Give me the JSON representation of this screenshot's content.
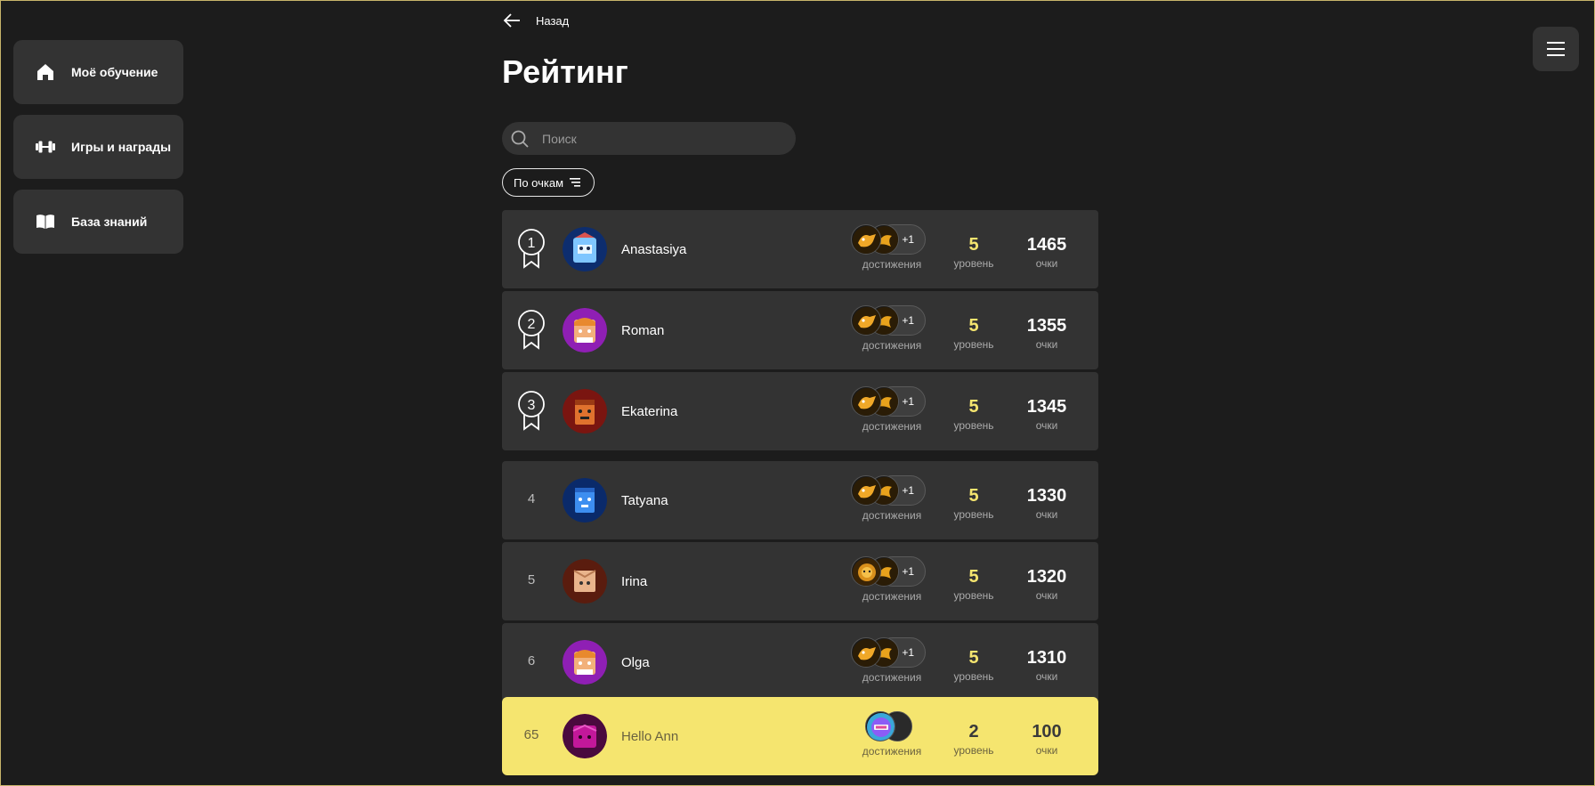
{
  "sidebar": {
    "items": [
      {
        "label": "Моё обучение",
        "icon": "home-icon"
      },
      {
        "label": "Игры и награды",
        "icon": "dumbbell-icon"
      },
      {
        "label": "База знаний",
        "icon": "book-icon"
      }
    ]
  },
  "header": {
    "back_label": "Назад",
    "title": "Рейтинг",
    "menu_icon": "hamburger-icon"
  },
  "search": {
    "placeholder": "Поиск",
    "value": ""
  },
  "sort": {
    "label": "По очкам",
    "icon": "sort-icon"
  },
  "captions": {
    "achievements": "достижения",
    "level": "уровень",
    "points": "очки"
  },
  "colors": {
    "background": "#1c1c1c",
    "card": "#333333",
    "accent": "#f5e56f"
  },
  "leaderboard": [
    {
      "rank": "1",
      "name": "Anastasiya",
      "extra": "+1",
      "level": "5",
      "points": "1465",
      "avatar_color": "#0d2d6e",
      "medal": true
    },
    {
      "rank": "2",
      "name": "Roman",
      "extra": "+1",
      "level": "5",
      "points": "1355",
      "avatar_color": "#8f1fb4",
      "medal": true
    },
    {
      "rank": "3",
      "name": "Ekaterina",
      "extra": "+1",
      "level": "5",
      "points": "1345",
      "avatar_color": "#7a1510",
      "medal": true
    },
    {
      "rank": "4",
      "name": "Tatyana",
      "extra": "+1",
      "level": "5",
      "points": "1330",
      "avatar_color": "#0a2a6a",
      "medal": false
    },
    {
      "rank": "5",
      "name": "Irina",
      "extra": "+1",
      "level": "5",
      "points": "1320",
      "avatar_color": "#5a1c0e",
      "medal": false
    },
    {
      "rank": "6",
      "name": "Olga",
      "extra": "+1",
      "level": "5",
      "points": "1310",
      "avatar_color": "#8f1fb4",
      "medal": false
    }
  ],
  "current_user": {
    "rank": "65",
    "name": "Hello Ann",
    "level": "2",
    "points": "100",
    "avatar_color": "#6e0f5a"
  }
}
